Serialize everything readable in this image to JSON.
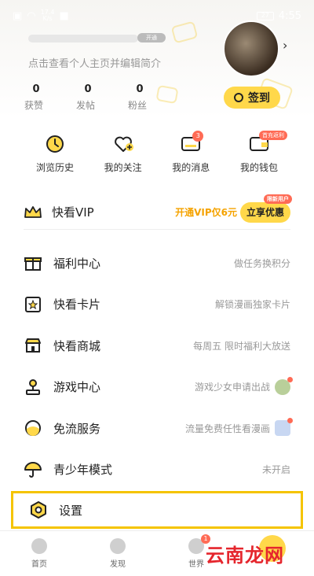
{
  "statusbar": {
    "netspeed_value": "17.4",
    "netspeed_unit": "K/s",
    "time": "4:55",
    "battery": "27"
  },
  "profile": {
    "bio_placeholder": "点击查看个人主页并编辑简介",
    "level_badge": "开通"
  },
  "stats": [
    {
      "value": "0",
      "label": "获赞"
    },
    {
      "value": "0",
      "label": "发帖"
    },
    {
      "value": "0",
      "label": "粉丝"
    }
  ],
  "checkin": {
    "label": "签到"
  },
  "quick": [
    {
      "label": "浏览历史",
      "icon": "clock-icon"
    },
    {
      "label": "我的关注",
      "icon": "heart-plus-icon"
    },
    {
      "label": "我的消息",
      "icon": "message-icon",
      "badge": "3"
    },
    {
      "label": "我的钱包",
      "icon": "wallet-icon",
      "tag": "首充返利"
    }
  ],
  "vip": {
    "title": "快看VIP",
    "promo": "开通VIP仅6元",
    "button": "立享优惠",
    "limited": "限新用户"
  },
  "menu": [
    {
      "label": "福利中心",
      "hint": "做任务换积分",
      "icon": "gift-icon"
    },
    {
      "label": "快看卡片",
      "hint": "解锁漫画独家卡片",
      "icon": "card-star-icon"
    },
    {
      "label": "快看商城",
      "hint": "每周五 限时福利大放送",
      "icon": "store-icon"
    },
    {
      "label": "游戏中心",
      "hint": "游戏少女申请出战",
      "icon": "joystick-icon"
    },
    {
      "label": "免流服务",
      "hint": "流量免费任性看漫画",
      "icon": "data-icon"
    },
    {
      "label": "青少年模式",
      "hint": "未开启",
      "icon": "umbrella-icon"
    }
  ],
  "settings": {
    "label": "设置"
  },
  "tabs": [
    {
      "label": "首页"
    },
    {
      "label": "发现"
    },
    {
      "label": "世界",
      "badge": "1"
    }
  ],
  "watermark": "云南龙网",
  "colors": {
    "accent": "#ffd84a",
    "badge": "#ff6b55",
    "highlight_border": "#f5c400"
  }
}
